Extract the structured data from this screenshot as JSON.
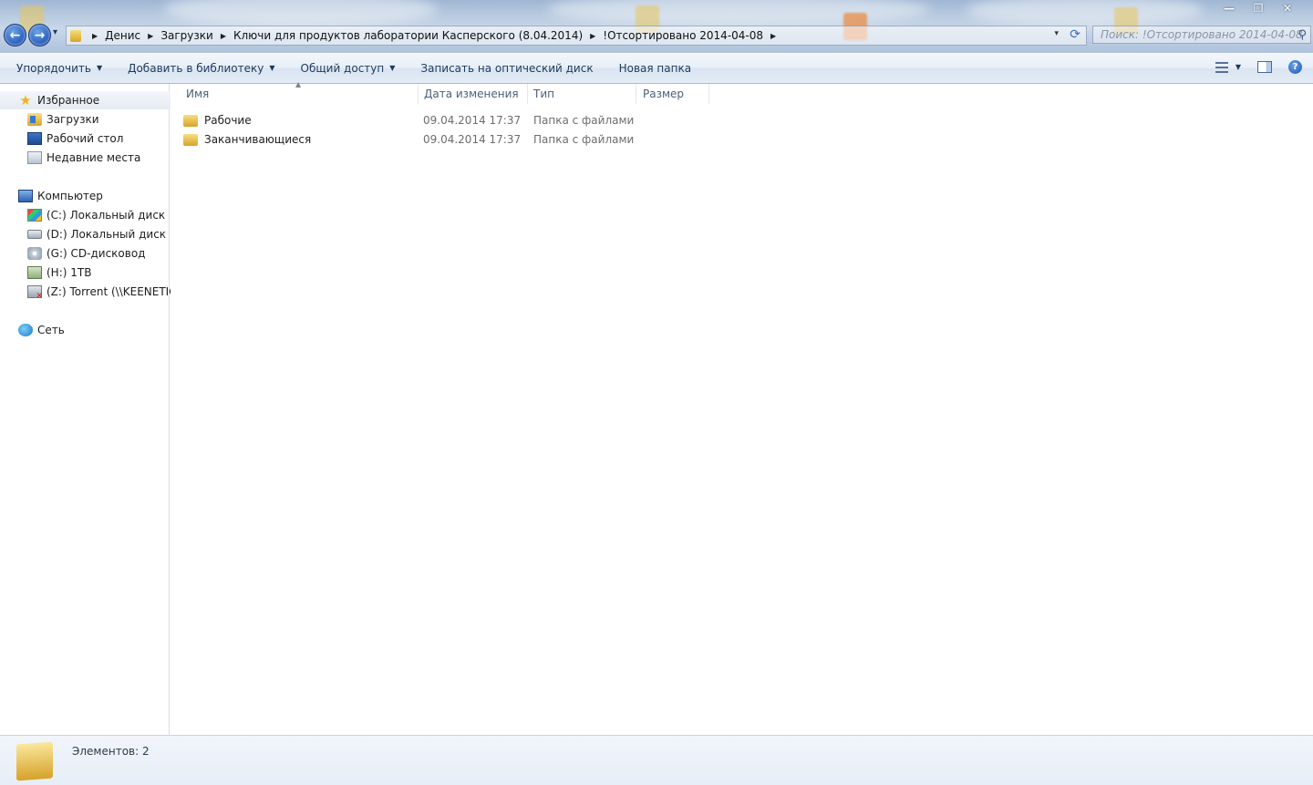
{
  "window": {
    "minimize_glyph": "—",
    "maximize_glyph": "❐",
    "close_glyph": "✕"
  },
  "nav": {
    "back_glyph": "←",
    "forward_glyph": "→",
    "history_glyph": "▾"
  },
  "address": {
    "crumbs": [
      "Денис",
      "Загрузки",
      "Ключи для продуктов лаборатории Касперского (8.04.2014)",
      "!Отсортировано 2014-04-08"
    ],
    "refresh_glyph": "⟳",
    "dropdown_glyph": "▾"
  },
  "search": {
    "placeholder": "Поиск: !Отсортировано 2014-04-08",
    "icon": "magnifier-icon"
  },
  "toolbar": {
    "organize": "Упорядочить",
    "add_to_library": "Добавить в библиотеку",
    "share": "Общий доступ",
    "burn": "Записать на оптический диск",
    "new_folder": "Новая папка"
  },
  "sidebar": {
    "favorites": {
      "label": "Избранное",
      "items": [
        "Загрузки",
        "Рабочий стол",
        "Недавние места"
      ]
    },
    "computer": {
      "label": "Компьютер",
      "items": [
        "(C:) Локальный диск",
        "(D:) Локальный диск",
        "(G:) CD-дисковод",
        "(H:) 1TB",
        "(Z:) Torrent (\\\\KEENETIC)"
      ]
    },
    "network": {
      "label": "Сеть"
    }
  },
  "columns": {
    "name": "Имя",
    "date": "Дата изменения",
    "type": "Тип",
    "size": "Размер"
  },
  "files": [
    {
      "name": "Рабочие",
      "date": "09.04.2014 17:37",
      "type": "Папка с файлами"
    },
    {
      "name": "Заканчивающиеся",
      "date": "09.04.2014 17:37",
      "type": "Папка с файлами"
    }
  ],
  "status": {
    "count": "Элементов: 2"
  },
  "colors": {
    "accent": "#1e395b",
    "folder": "#e8c14f",
    "selection": "#e5ebf2"
  }
}
